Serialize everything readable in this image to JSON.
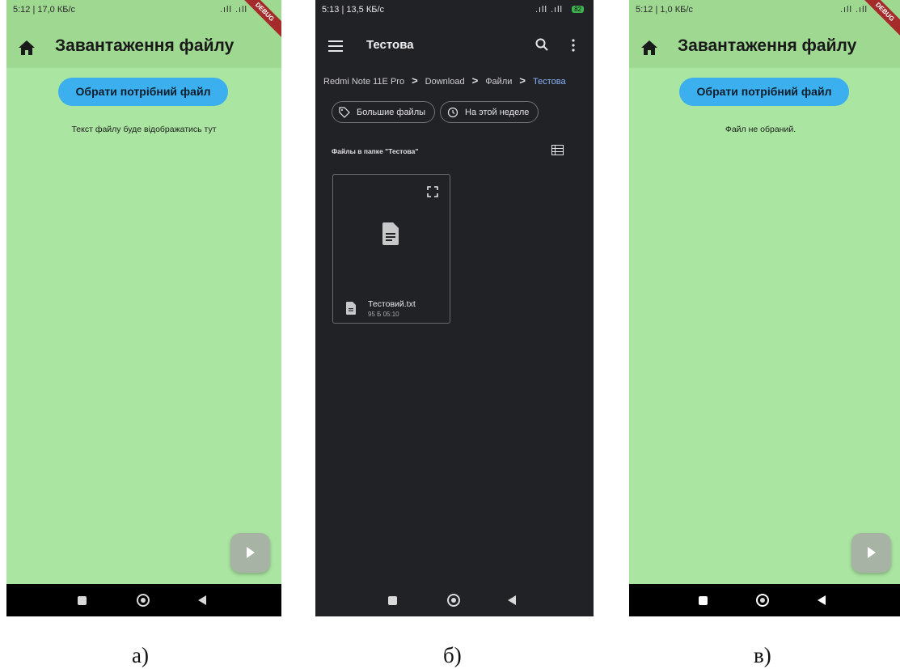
{
  "screen_a": {
    "status_left": "5:12 | 17,0 КБ/с",
    "status_right": ".ıll .ıll",
    "debug_banner": "DEBUG",
    "title": "Завантаження файлу",
    "pick_button": "Обрати потрібний файл",
    "body_text": "Текст файлу буде відображатись тут",
    "caption": "а)"
  },
  "screen_b": {
    "status_left": "5:13 | 13,5 КБ/с",
    "status_right": ".ıll .ıll",
    "battery": "82",
    "title": "Тестова",
    "breadcrumbs": [
      "Redmi Note 11E Pro",
      "Download",
      "Файли",
      "Тестова"
    ],
    "chips": [
      "Большие файлы",
      "На этой неделе"
    ],
    "section_label": "Файлы в папке \"Тестова\"",
    "file": {
      "name": "Тестовий.txt",
      "meta": "95 Б 05:10"
    },
    "caption": "б)"
  },
  "screen_c": {
    "status_left": "5:12 | 1,0 КБ/с",
    "status_right": ".ıll .ıll",
    "debug_banner": "DEBUG",
    "title": "Завантаження файлу",
    "pick_button": "Обрати потрібний файл",
    "body_text": "Файл не обраний.",
    "caption": "в)"
  },
  "colors": {
    "app_bar": "#9ed891",
    "app_body": "#abe5a2",
    "button": "#3cb0ee",
    "fm_background": "#212226",
    "fm_accent": "#8ab4f8"
  }
}
